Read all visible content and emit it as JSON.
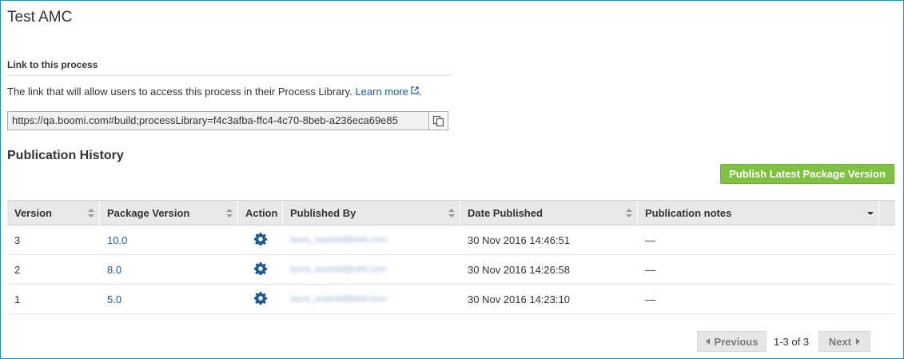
{
  "page": {
    "title": "Test AMC"
  },
  "link_section": {
    "title": "Link to this process",
    "description": "The link that will allow users to access this process in their Process Library.",
    "learn_more": "Learn more",
    "url": "https://qa.boomi.com#build;processLibrary=f4c3afba-ffc4-4c70-8beb-a236eca69e85",
    "copy_icon": "copy-icon"
  },
  "publication": {
    "title": "Publication History",
    "publish_button": "Publish Latest Package Version",
    "columns": [
      "Version",
      "Package Version",
      "Action",
      "Published By",
      "Date Published",
      "Publication notes"
    ],
    "rows": [
      {
        "version": "3",
        "package_version": "10.0",
        "published_by": "laura_seybold@dell.com",
        "date": "30 Nov 2016 14:46:51",
        "notes": "—"
      },
      {
        "version": "2",
        "package_version": "8.0",
        "published_by": "laura_seybold@dell.com",
        "date": "30 Nov 2016 14:26:58",
        "notes": "—"
      },
      {
        "version": "1",
        "package_version": "5.0",
        "published_by": "laura_seybold@dell.com",
        "date": "30 Nov 2016 14:23:10",
        "notes": "—"
      }
    ]
  },
  "pagination": {
    "previous": "Previous",
    "info": "1-3 of 3",
    "next": "Next"
  },
  "colors": {
    "accent": "#7fc241",
    "link": "#1a5a96",
    "border": "#1f8ec2"
  }
}
